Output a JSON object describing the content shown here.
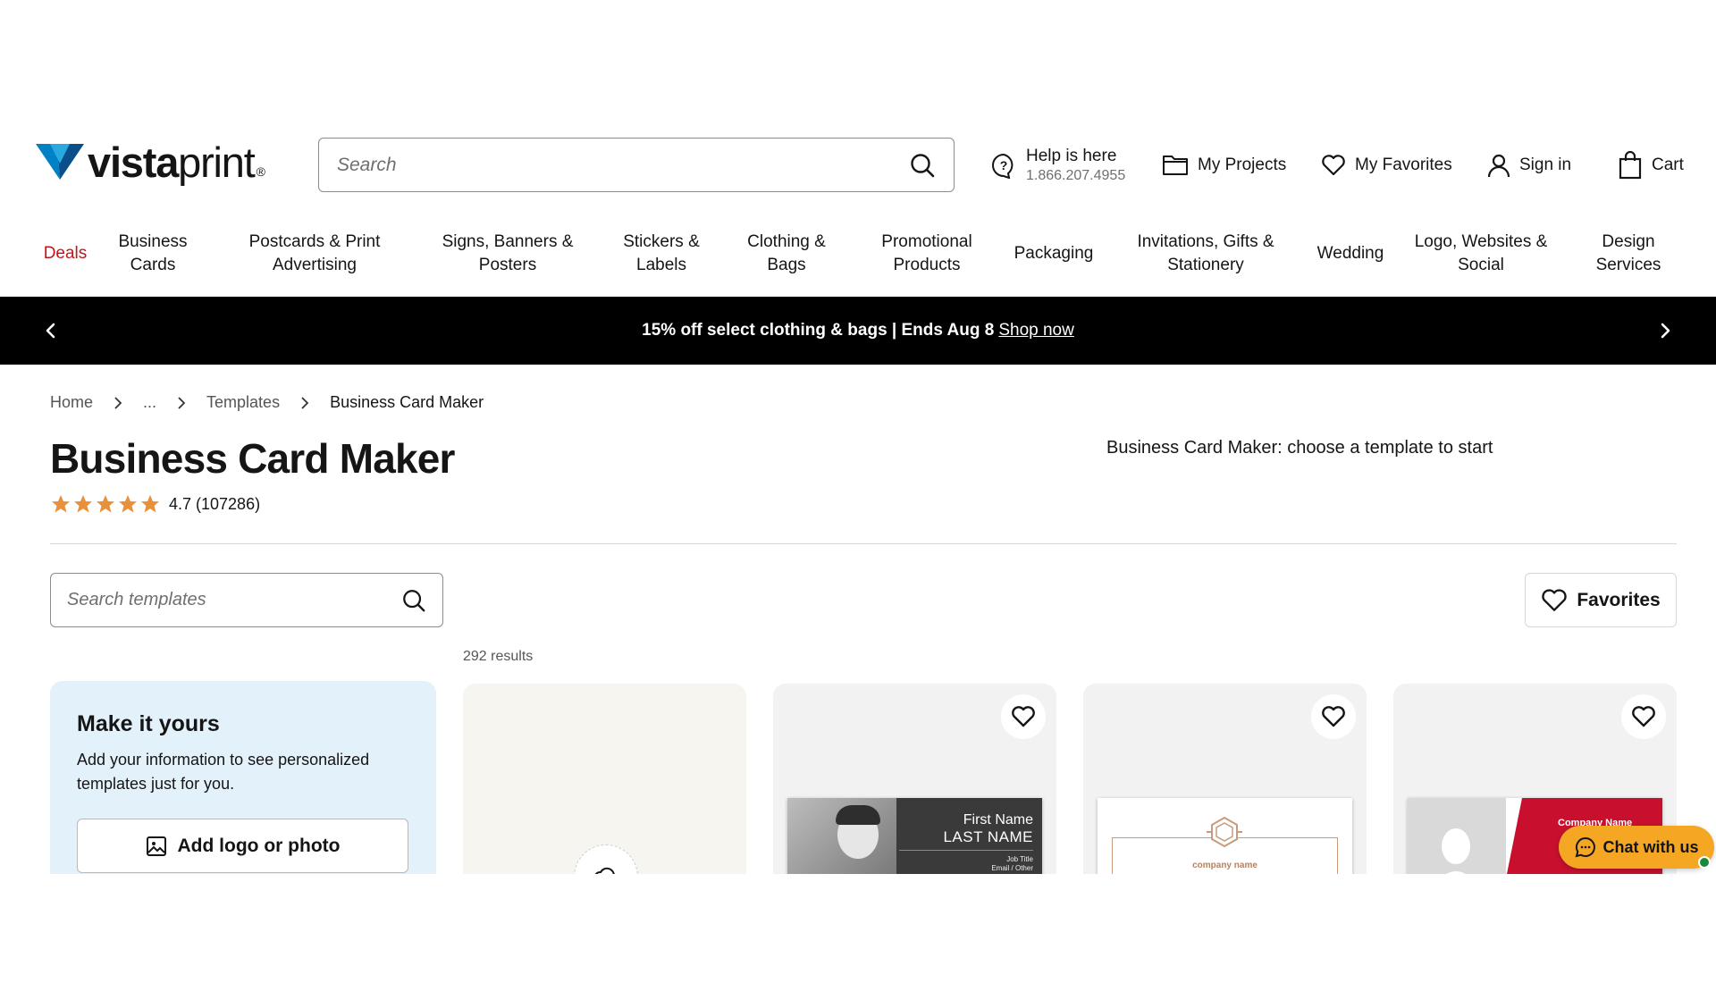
{
  "header": {
    "logo_text_bold": "vista",
    "logo_text_light": "print",
    "logo_dot": "®",
    "search_placeholder": "Search",
    "help_label": "Help is here",
    "help_phone": "1.866.207.4955",
    "projects_label": "My Projects",
    "favorites_label": "My Favorites",
    "signin_label": "Sign in",
    "cart_label": "Cart"
  },
  "nav": {
    "items": [
      {
        "label": "Deals"
      },
      {
        "label": "Business Cards"
      },
      {
        "label": "Postcards & Print Advertising"
      },
      {
        "label": "Signs, Banners & Posters"
      },
      {
        "label": "Stickers & Labels"
      },
      {
        "label": "Clothing & Bags"
      },
      {
        "label": "Promotional Products"
      },
      {
        "label": "Packaging"
      },
      {
        "label": "Invitations, Gifts & Stationery"
      },
      {
        "label": "Wedding"
      },
      {
        "label": "Logo, Websites & Social"
      },
      {
        "label": "Design Services"
      }
    ]
  },
  "promo": {
    "text": "15% off select clothing & bags | Ends Aug 8",
    "link": "Shop now"
  },
  "breadcrumb": {
    "items": [
      "Home",
      "...",
      "Templates",
      "Business Card Maker"
    ]
  },
  "page": {
    "title": "Business Card Maker",
    "rating_value": 5,
    "rating_text": "4.7 (107286)",
    "subtitle": "Business Card Maker: choose a template to start",
    "template_search_placeholder": "Search templates",
    "favorites_button": "Favorites",
    "results": "292 results"
  },
  "make_card": {
    "title": "Make it yours",
    "description": "Add your information to see personalized templates just for you.",
    "button": "Add logo or photo"
  },
  "templates": [
    {
      "first_name": "First Name",
      "last_name": "LAST NAME",
      "job_line1": "Job Title",
      "job_line2": "Email / Other"
    },
    {
      "company": "company name"
    },
    {
      "company": "Company Name"
    }
  ],
  "chat": {
    "label": "Chat with us"
  },
  "colors": {
    "brand_blue": "#006196",
    "deals_red": "#c4141a",
    "chat_orange": "#f5a623",
    "star": "#e8913a"
  }
}
